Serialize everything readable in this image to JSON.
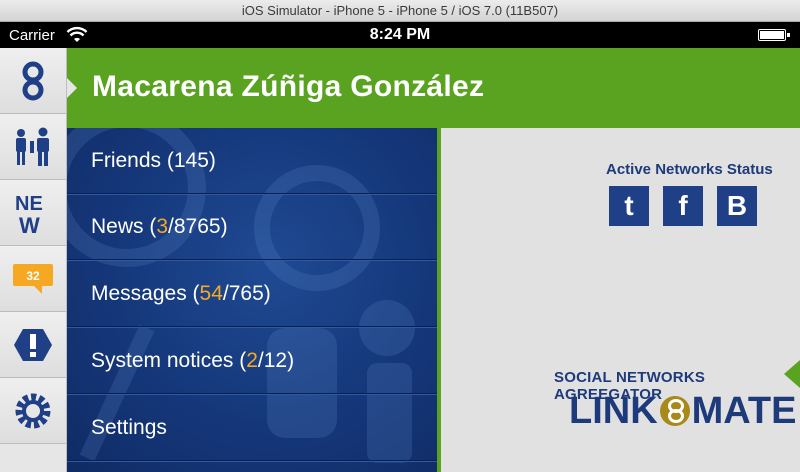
{
  "simulator": {
    "title": "iOS Simulator - iPhone 5 - iPhone 5 / iOS 7.0 (11B507)"
  },
  "status_bar": {
    "carrier": "Carrier",
    "time": "8:24 PM"
  },
  "rail": {
    "items": [
      {
        "icon": "link-logo-icon"
      },
      {
        "icon": "friends-icon"
      },
      {
        "icon": "news-icon"
      },
      {
        "icon": "message-bubble-icon",
        "badge": "32"
      },
      {
        "icon": "alert-icon"
      },
      {
        "icon": "gear-icon"
      }
    ]
  },
  "header": {
    "title": "Macarena Zúñiga González"
  },
  "menu": {
    "items": [
      {
        "label": "Friends (145)"
      },
      {
        "label_prefix": "News (",
        "highlight": "3",
        "label_suffix": "/8765)"
      },
      {
        "label_prefix": "Messages (",
        "highlight": "54",
        "label_suffix": "/765)"
      },
      {
        "label_prefix": "System notices (",
        "highlight": "2",
        "label_suffix": "/12)"
      },
      {
        "label": "Settings"
      }
    ]
  },
  "networks": {
    "title": "Active Networks Status",
    "buttons": [
      {
        "letter": "t",
        "icon": "tumblr-icon"
      },
      {
        "letter": "f",
        "icon": "facebook-icon"
      },
      {
        "letter": "B",
        "icon": "blogger-icon"
      }
    ]
  },
  "brand": {
    "tagline": "SOCIAL NETWORKS AGREEGATOR",
    "logo_left": "LINK",
    "logo_right": "MATE"
  },
  "colors": {
    "header_green": "#5aa321",
    "menu_blue": "#15377a",
    "highlight_orange": "#f7a823",
    "brand_blue": "#1d3a7a"
  }
}
